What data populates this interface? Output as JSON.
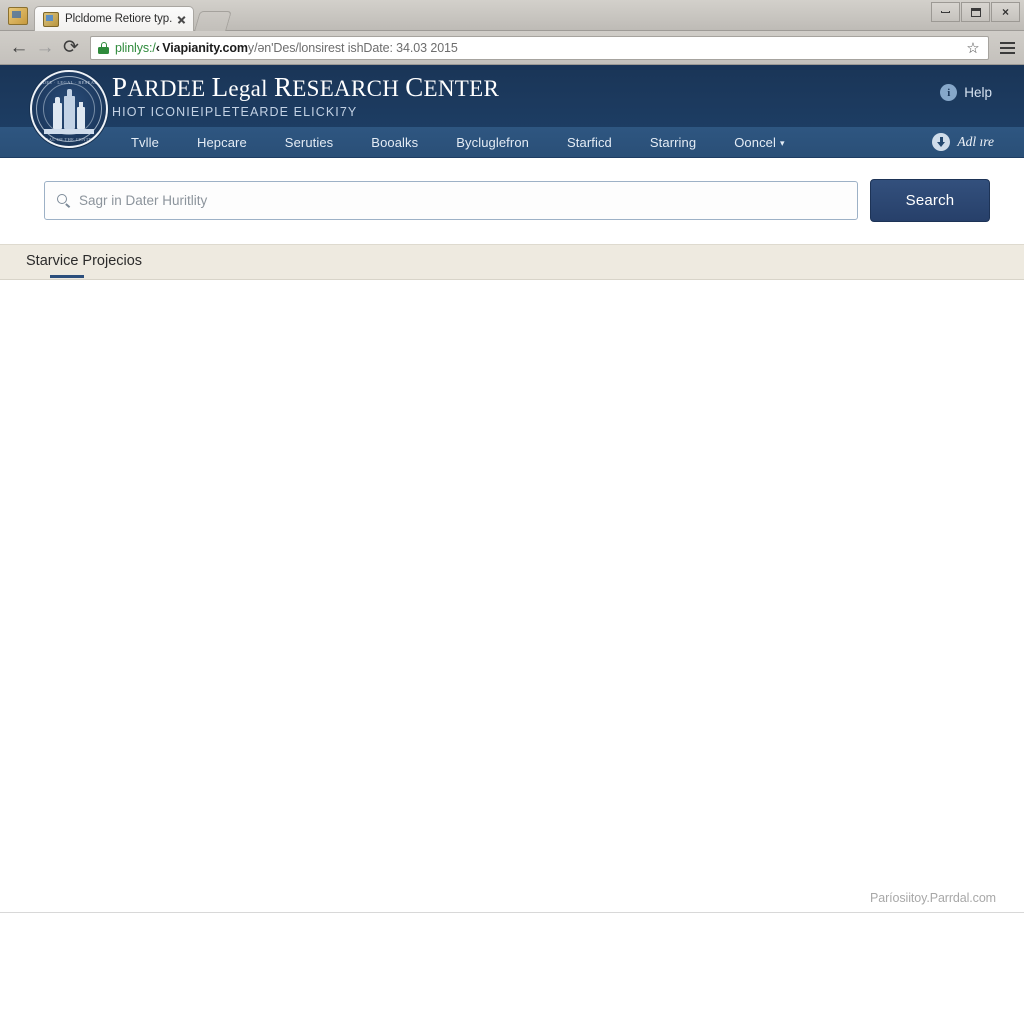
{
  "browser": {
    "tab": {
      "title": "Plcldome Retiore typ.",
      "favicon": "folder-icon",
      "close": "×"
    },
    "newtab_label": "",
    "window_controls": {
      "minimize": "minimize-icon",
      "maximize": "maximize-icon",
      "close": "×"
    },
    "toolbar": {
      "back": "←",
      "forward": "→",
      "reload": "⟳",
      "lock": "lock-icon",
      "url_scheme": "plinlys:/",
      "url_host": "‹ Viapianity.com",
      "url_path": "y/ən'Des/lonsirest ishDate: 34.03 2015",
      "url_full": "plinlys:/‹Viapianity.comy/ən'Des/lonsirestishDate: 34.03 2015",
      "star": "☆",
      "menu": "hamburger-icon"
    }
  },
  "site": {
    "seal": {
      "text_top": "PARDEE · LEGAL · RESEARCH",
      "text_bottom": "SEAL OF THE CENTER"
    },
    "title_parts": [
      {
        "cap": "P",
        "rest": "ARDEE"
      },
      {
        "cap": "L",
        "rest": "egal"
      },
      {
        "cap": "R",
        "rest": "ESEARCH"
      },
      {
        "cap": "C",
        "rest": "ENTER"
      }
    ],
    "title": "PARDEE Legal RESEARCH CENTER",
    "subtitle": "HIOT ICONIEIPLETEARDE ELICKI7Y",
    "help": {
      "label": "Help",
      "icon": "info-icon"
    },
    "archive": {
      "label": "Adl ıre",
      "icon": "download-circle-icon"
    },
    "nav": [
      {
        "label": "Tvlle",
        "has_caret": false
      },
      {
        "label": "Hepcare",
        "has_caret": false
      },
      {
        "label": "Seruties",
        "has_caret": false
      },
      {
        "label": "Booalks",
        "has_caret": false
      },
      {
        "label": "Bycluglefron",
        "has_caret": false
      },
      {
        "label": "Starficd",
        "has_caret": false
      },
      {
        "label": "Starring",
        "has_caret": false
      },
      {
        "label": "Ooncel",
        "has_caret": true,
        "caret": "▾"
      }
    ]
  },
  "search": {
    "placeholder": "Sagr in Dater Huritlity",
    "value": "",
    "icon": "search-icon",
    "button_label": "Search"
  },
  "section": {
    "active_tab": "Starvice Projecios"
  },
  "footer": {
    "text": "Paríosiitoy.Parrdal.com"
  },
  "colors": {
    "header_navy": "#1a3557",
    "nav_navy": "#2e5681",
    "button_navy": "#27406a",
    "section_beige": "#eeeae0",
    "accent_underline": "#2c4f7c"
  }
}
